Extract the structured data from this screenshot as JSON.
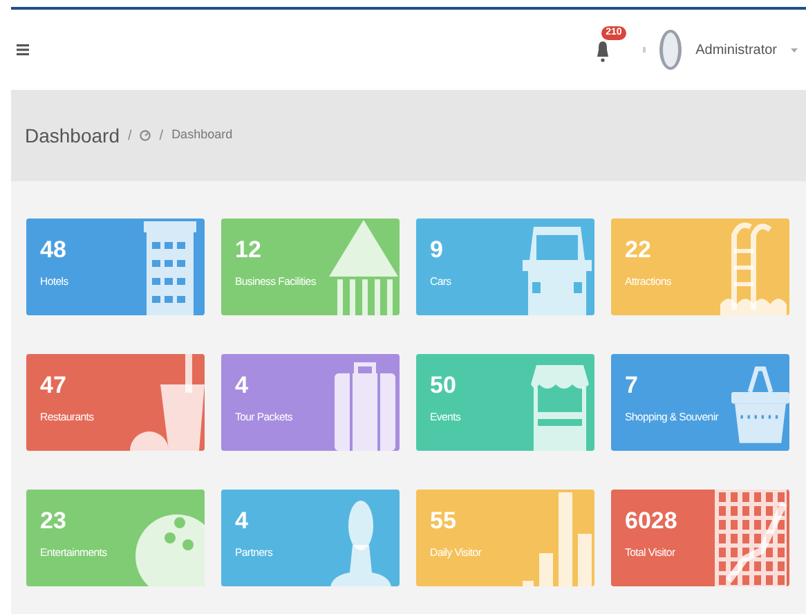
{
  "navbar": {
    "notification_count": "210",
    "user_name": "Administrator"
  },
  "breadcrumb": {
    "title": "Dashboard",
    "separator": "/",
    "items": [
      {
        "label": "Dashboard"
      }
    ]
  },
  "tiles": [
    {
      "value": "48",
      "label": "Hotels",
      "color": "#4a9fe0",
      "kind": "hotel"
    },
    {
      "value": "12",
      "label": "Business Facilities",
      "color": "#80cc74",
      "kind": "temple"
    },
    {
      "value": "9",
      "label": "Cars",
      "color": "#54b6e0",
      "kind": "car"
    },
    {
      "value": "22",
      "label": "Attractions",
      "color": "#f5c15a",
      "kind": "pool"
    },
    {
      "value": "47",
      "label": "Restaurants",
      "color": "#e46a58",
      "kind": "drink"
    },
    {
      "value": "4",
      "label": "Tour Packets",
      "color": "#a78ddf",
      "kind": "suitcase"
    },
    {
      "value": "50",
      "label": "Events",
      "color": "#4ec9a8",
      "kind": "stall"
    },
    {
      "value": "7",
      "label": "Shopping & Souvenir",
      "color": "#4a9fe0",
      "kind": "basket"
    },
    {
      "value": "23",
      "label": "Entertainments",
      "color": "#80cc74",
      "kind": "bowling"
    },
    {
      "value": "4",
      "label": "Partners",
      "color": "#54b6e0",
      "kind": "person"
    },
    {
      "value": "55",
      "label": "Daily Visitor",
      "color": "#f5c15a",
      "kind": "bars"
    },
    {
      "value": "6028",
      "label": "Total Visitor",
      "color": "#e56a58",
      "kind": "grid"
    }
  ]
}
